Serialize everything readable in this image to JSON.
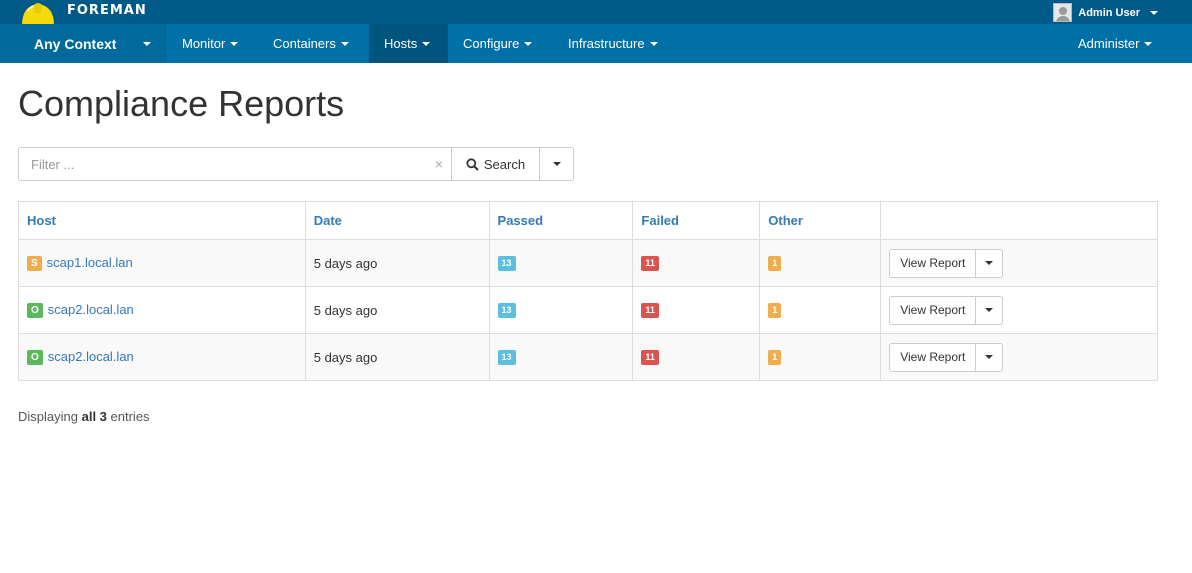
{
  "brand": {
    "name": "FOREMAN"
  },
  "user": {
    "name": "Admin User"
  },
  "nav": {
    "context": "Any Context",
    "items": [
      {
        "label": "Monitor"
      },
      {
        "label": "Containers"
      },
      {
        "label": "Hosts"
      },
      {
        "label": "Configure"
      },
      {
        "label": "Infrastructure"
      }
    ],
    "right": "Administer"
  },
  "page": {
    "title": "Compliance Reports"
  },
  "search": {
    "placeholder": "Filter ...",
    "clear": "×",
    "button_label": "Search"
  },
  "table": {
    "headers": {
      "host": "Host",
      "date": "Date",
      "passed": "Passed",
      "failed": "Failed",
      "other": "Other"
    },
    "rows": [
      {
        "status": "S",
        "host": "scap1.local.lan",
        "date": "5 days ago",
        "passed": "13",
        "failed": "11",
        "other": "1",
        "action": "View Report"
      },
      {
        "status": "O",
        "host": "scap2.local.lan",
        "date": "5 days ago",
        "passed": "13",
        "failed": "11",
        "other": "1",
        "action": "View Report"
      },
      {
        "status": "O",
        "host": "scap2.local.lan",
        "date": "5 days ago",
        "passed": "13",
        "failed": "11",
        "other": "1",
        "action": "View Report"
      }
    ]
  },
  "footer": {
    "prefix": "Displaying",
    "count": "all 3",
    "suffix": "entries"
  },
  "colors": {
    "topbar": "#005a87",
    "navbar": "#0071a6",
    "link": "#337ab7",
    "passed": "#5bc0de",
    "failed": "#d9534f",
    "other": "#f0ad4e",
    "status_o": "#5cb85c",
    "status_s": "#f0ad4e"
  },
  "icons": {
    "logo": "helmet-icon",
    "search": "search-icon",
    "avatar": "user-avatar-icon"
  }
}
